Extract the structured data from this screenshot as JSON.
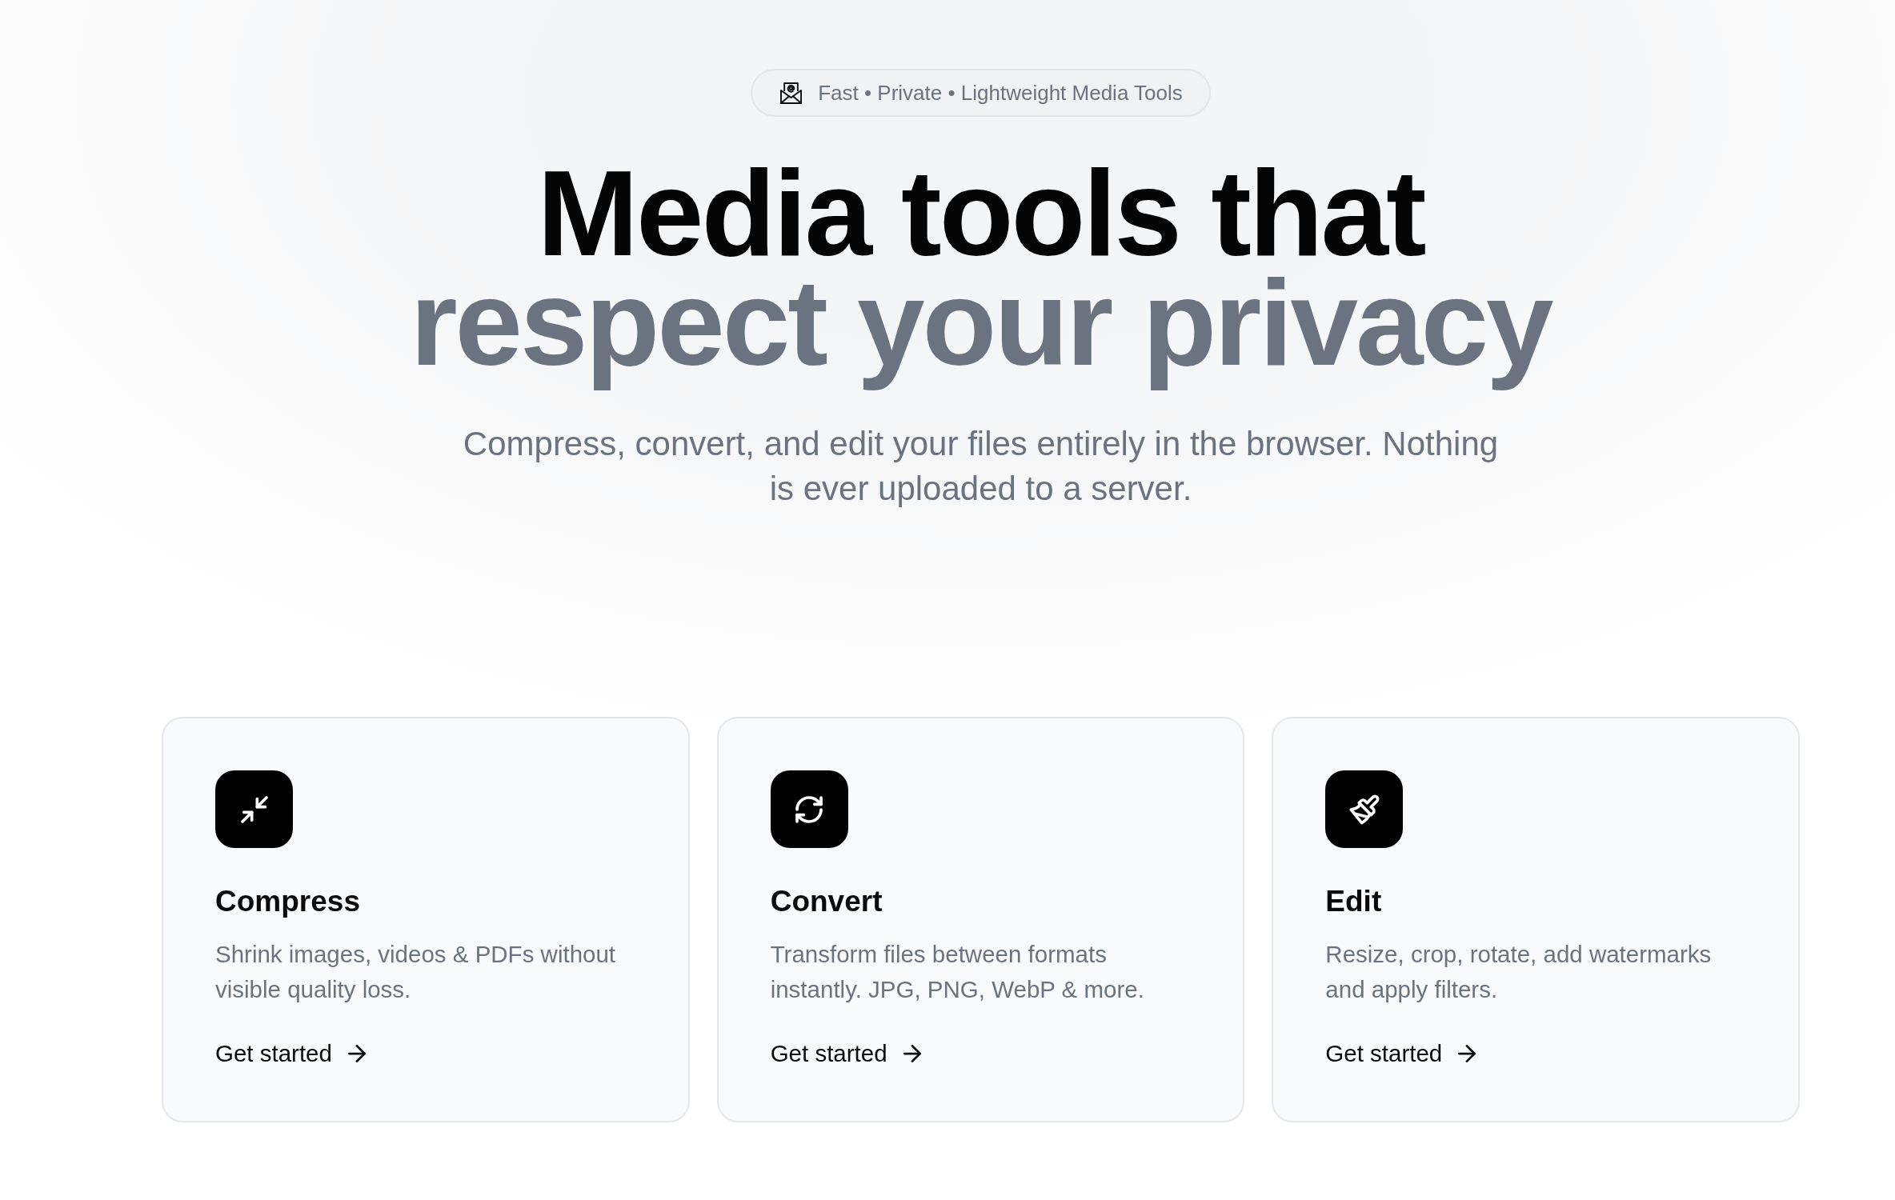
{
  "badge": {
    "text": "Fast • Private • Lightweight Media Tools"
  },
  "headline": {
    "line_1": "Media tools that",
    "line_2": "respect your privacy"
  },
  "subtitle": "Compress, convert, and edit your files entirely in the browser. Nothing is ever uploaded to a server.",
  "cards": [
    {
      "kind": "compress",
      "title": "Compress",
      "description": "Shrink images, videos & PDFs without visible quality loss.",
      "link": "Get started"
    },
    {
      "kind": "convert",
      "title": "Convert",
      "description": "Transform files between formats instantly. JPG, PNG, WebP & more.",
      "link": "Get started"
    },
    {
      "kind": "edit",
      "title": "Edit",
      "description": "Resize, crop, rotate, add watermarks and apply filters.",
      "link": "Get started"
    }
  ]
}
